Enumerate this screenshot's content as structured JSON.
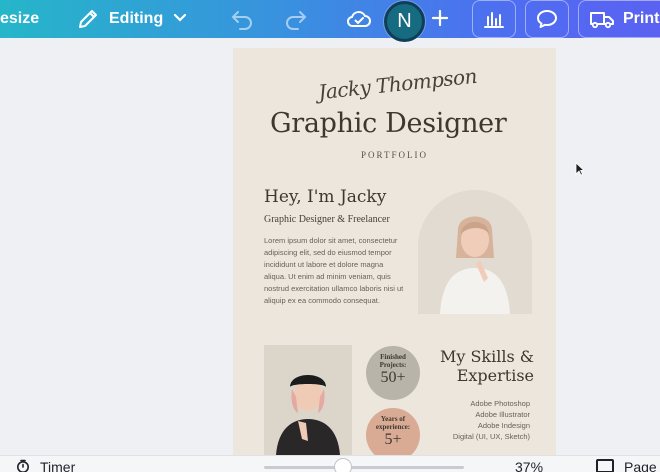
{
  "toolbar": {
    "resize_label": "esize",
    "editing_label": "Editing",
    "avatar_initial": "N",
    "print_label": "Print"
  },
  "design": {
    "signature": "Jacky Thompson",
    "headline": "Graphic Designer",
    "tagline": "PORTFOLIO",
    "greeting": "Hey, I'm Jacky",
    "role": "Graphic Designer & Freelancer",
    "about": "Lorem ipsum dolor sit amet, consectetur adipiscing elit, sed do eiusmod tempor incididunt ut labore et dolore magna aliqua. Ut enim ad minim veniam, quis nostrud exercitation ullamco laboris nisi ut aliquip ex ea commodo consequat.",
    "stats": [
      {
        "label": "Finished Projects:",
        "value": "50+"
      },
      {
        "label": "Years of experience:",
        "value": "5+"
      }
    ],
    "skills_title": "My Skills & Expertise",
    "skills": [
      "Adobe Photoshop",
      "Adobe Illustrator",
      "Adobe Indesign",
      "Digital (UI, UX, Sketch)"
    ]
  },
  "bottom_bar": {
    "timer_label": "Timer",
    "zoom_label": "37%",
    "pages_label": "Page"
  },
  "colors": {
    "toolbar_start": "#25b6c9",
    "toolbar_end": "#5b61f2",
    "page_background": "#ece6dc",
    "avatar": "#166b80"
  }
}
